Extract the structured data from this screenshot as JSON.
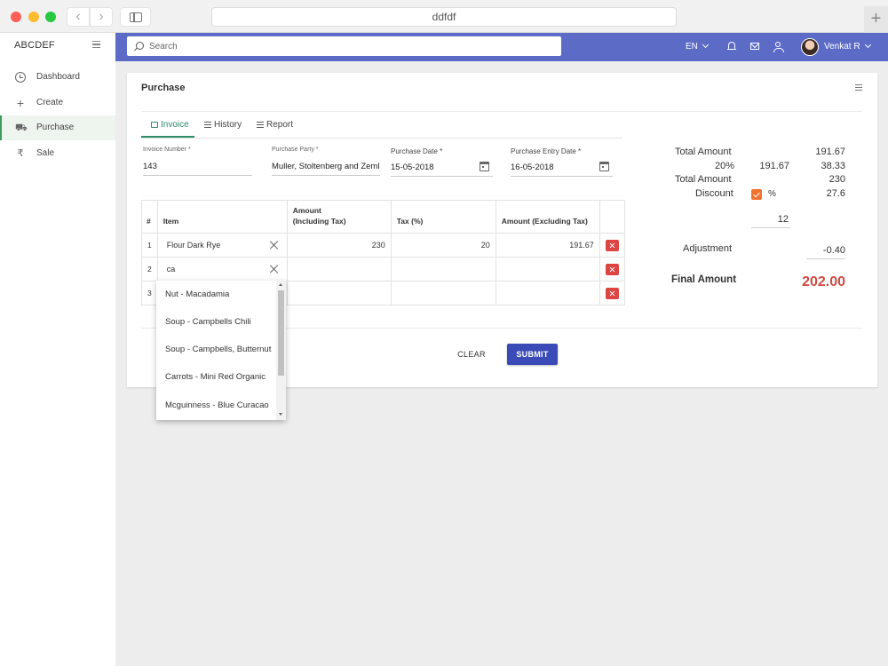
{
  "browser": {
    "address": "ddfdf"
  },
  "sidebar": {
    "brand": "ABCDEF",
    "items": [
      {
        "label": "Dashboard",
        "icon": "dashboard-icon"
      },
      {
        "label": "Create",
        "icon": "plus-icon"
      },
      {
        "label": "Purchase",
        "icon": "cart-icon"
      },
      {
        "label": "Sale",
        "icon": "rupee-icon"
      }
    ]
  },
  "topbar": {
    "search_placeholder": "Search",
    "language": "EN",
    "user_name": "Venkat R"
  },
  "card": {
    "title": "Purchase",
    "tabs": [
      {
        "label": "Invoice"
      },
      {
        "label": "History"
      },
      {
        "label": "Report"
      }
    ]
  },
  "form": {
    "invoice_number": {
      "label": "Invoice Number *",
      "value": "143"
    },
    "purchase_party": {
      "label": "Purchase Party *",
      "value": "Muller, Stoltenberg and Zeml"
    },
    "purchase_date": {
      "label": "Purchase Date *",
      "value": "15-05-2018"
    },
    "purchase_entry_date": {
      "label": "Purchase Entry Date *",
      "value": "16-05-2018"
    }
  },
  "table": {
    "headers": {
      "index": "#",
      "item": "Item",
      "amount_incl_line1": "Amount",
      "amount_incl_line2": "(Including Tax)",
      "tax": "Tax (%)",
      "amount_excl": "Amount (Excluding Tax)"
    },
    "rows": [
      {
        "index": "1",
        "item": "Flour Dark Rye",
        "amount_incl": "230",
        "tax": "20",
        "amount_excl": "191.67"
      },
      {
        "index": "2",
        "item": "ca",
        "amount_incl": "",
        "tax": "",
        "amount_excl": ""
      },
      {
        "index": "3",
        "item": "",
        "amount_incl": "",
        "tax": "",
        "amount_excl": ""
      }
    ]
  },
  "dropdown": {
    "options": [
      "Nut - Macadamia",
      "Soup - Campbells Chili",
      "Soup - Campbells, Butternut",
      "Carrots - Mini Red Organic",
      "Mcguinness - Blue Curacao"
    ]
  },
  "summary": {
    "total_amount_label": "Total Amount",
    "total_amount_value": "191.67",
    "tax_rate_label": "20%",
    "tax_base_value": "191.67",
    "tax_value": "38.33",
    "total_amount2_label": "Total Amount",
    "total_amount2_value": "230",
    "discount_label": "Discount",
    "discount_unit": "%",
    "discount_value": "27.6",
    "discount_input": "12",
    "adjustment_label": "Adjustment",
    "adjustment_value": "-0.40",
    "final_label": "Final Amount",
    "final_value": "202.00"
  },
  "actions": {
    "clear": "CLEAR",
    "submit": "SUBMIT"
  },
  "colors": {
    "topbar": "#5c6bc6",
    "accent": "#2f8d6a",
    "submit": "#3a4bb7",
    "danger": "#dd4444",
    "checkbox": "#f1722e",
    "final": "#d04a43"
  }
}
